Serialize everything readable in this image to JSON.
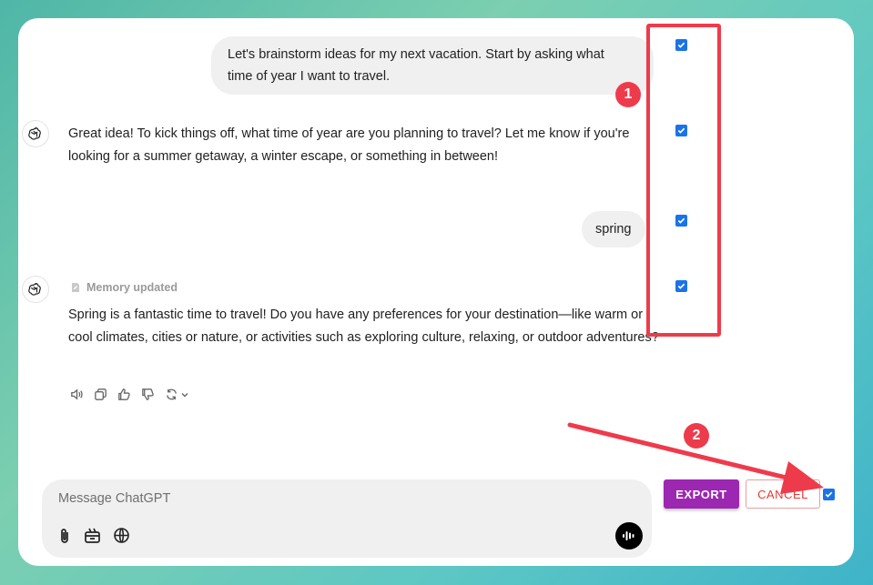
{
  "conversation": {
    "user_msg_1": "Let's brainstorm ideas for my next vacation. Start by asking what time of year I want to travel.",
    "assistant_msg_1": "Great idea! To kick things off, what time of year are you planning to travel? Let me know if you're looking for a summer getaway, a winter escape, or something in between!",
    "user_msg_2": "spring",
    "memory_label": "Memory updated",
    "assistant_msg_2": "Spring is a fantastic time to travel! Do you have any preferences for your destination—like warm or cool climates, cities or nature, or activities such as exploring culture, relaxing, or outdoor adventures?"
  },
  "annotations": {
    "badge_1": "1",
    "badge_2": "2",
    "accent_color": "#ee3b4b"
  },
  "selection": {
    "checkboxes_checked": [
      true,
      true,
      true,
      true
    ],
    "select_all_checked": true,
    "checkbox_color": "#1a73e8"
  },
  "composer": {
    "placeholder": "Message ChatGPT",
    "icons": [
      "paperclip-icon",
      "tools-icon",
      "globe-icon",
      "voice-mode-icon"
    ]
  },
  "buttons": {
    "export_label": "EXPORT",
    "cancel_label": "CANCEL",
    "export_color": "#9c27b0",
    "cancel_color": "#e53935"
  },
  "message_actions": [
    "read-aloud-icon",
    "copy-icon",
    "thumbs-up-icon",
    "thumbs-down-icon",
    "regenerate-icon"
  ]
}
